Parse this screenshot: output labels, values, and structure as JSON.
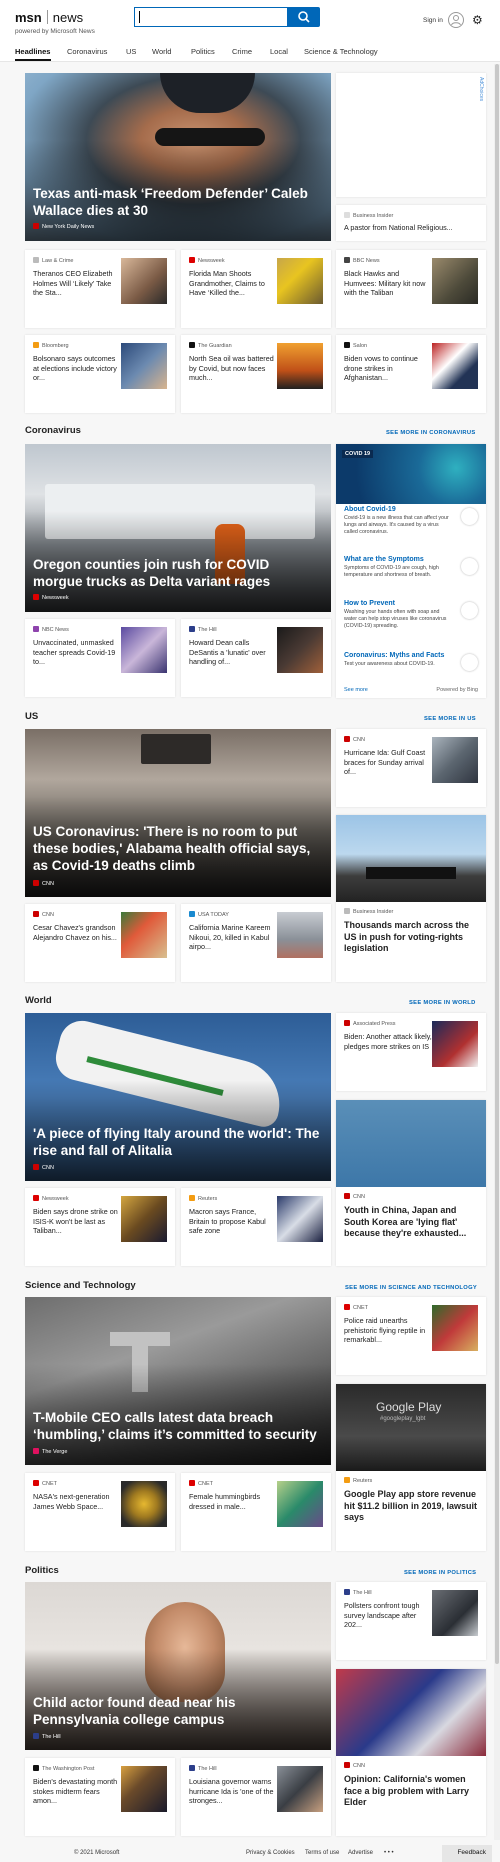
{
  "header": {
    "logo_text": "msn",
    "news": "news",
    "powered": "powered by Microsoft News",
    "sign_in": "Sign in",
    "search_value": ""
  },
  "nav": [
    "Headlines",
    "Coronavirus",
    "US",
    "World",
    "Politics",
    "Crime",
    "Local",
    "Science & Technology"
  ],
  "top": {
    "hero": {
      "title": "Texas anti-mask ‘Freedom Defender’ Caleb Wallace dies at 30",
      "source": "New York Daily News"
    },
    "side": {
      "source": "Business Insider",
      "title": "A pastor from National Religious..."
    },
    "ad_label": "AdChoices",
    "stories": [
      {
        "source": "Law & Crime",
        "title": "Theranos CEO Elizabeth Holmes Will ‘Likely’ Take the Sta..."
      },
      {
        "source": "Newsweek",
        "title": "Florida Man Shoots Grandmother, Claims to Have ‘Killed the..."
      },
      {
        "source": "BBC News",
        "title": "Black Hawks and Humvees: Military kit now with the Taliban"
      },
      {
        "source": "Bloomberg",
        "title": "Bolsonaro says outcomes at elections include victory or..."
      },
      {
        "source": "The Guardian",
        "title": "North Sea oil was battered by Covid, but now faces much..."
      },
      {
        "source": "Salon",
        "title": "Biden vows to continue drone strikes in Afghanistan..."
      }
    ]
  },
  "coronavirus": {
    "heading": "Coronavirus",
    "more": "SEE MORE IN CORONAVIRUS",
    "hero": {
      "title": "Oregon counties join rush for COVID morgue trucks as Delta variant rages",
      "source": "Newsweek"
    },
    "stories": [
      {
        "source": "NBC News",
        "title": "Unvaccinated, unmasked teacher spreads Covid-19 to..."
      },
      {
        "source": "The Hill",
        "title": "Howard Dean calls DeSantis a 'lunatic' over handling of..."
      }
    ],
    "panel": {
      "badge": "COVID 19",
      "items": [
        {
          "h": "About Covid-19",
          "d": "Covid-19 is a new illness that can affect your lungs and airways. It's caused by a virus called coronavirus."
        },
        {
          "h": "What are the Symptoms",
          "d": "Symptoms of COVID-19 are cough, high temperature and shortness of breath."
        },
        {
          "h": "How to Prevent",
          "d": "Washing your hands often with soap and water can help stop viruses like coronavirus (COVID-19) spreading."
        },
        {
          "h": "Coronavirus: Myths and Facts",
          "d": "Test your awareness about COVID-19."
        }
      ],
      "see_more": "See more",
      "powered": "Powered by Bing"
    }
  },
  "us": {
    "heading": "US",
    "more": "SEE MORE IN US",
    "hero": {
      "title": "US Coronavirus: 'There is no room to put these bodies,' Alabama health official says, as Covid-19 deaths climb",
      "source": "CNN"
    },
    "side": {
      "source": "CNN",
      "title": "Hurricane Ida: Gulf Coast braces for Sunday arrival of..."
    },
    "stories": [
      {
        "source": "CNN",
        "title": "Cesar Chavez's grandson Alejandro Chavez on his..."
      },
      {
        "source": "USA TODAY",
        "title": "California Marine Kareem Nikoui, 20, killed in Kabul airpo..."
      }
    ],
    "feature": {
      "source": "Business Insider",
      "title": "Thousands march across the US in push for voting-rights legislation"
    }
  },
  "world": {
    "heading": "World",
    "more": "SEE MORE IN WORLD",
    "hero": {
      "title": "'A piece of flying Italy around the world': The rise and fall of Alitalia",
      "source": "CNN"
    },
    "side": {
      "source": "Associated Press",
      "title": "Biden: Another attack likely, pledges more strikes on IS"
    },
    "stories": [
      {
        "source": "Newsweek",
        "title": "Biden says drone strike on ISIS-K won't be last as Taliban..."
      },
      {
        "source": "Reuters",
        "title": "Macron says France, Britain to propose Kabul safe zone"
      }
    ],
    "feature": {
      "source": "CNN",
      "title": "Youth in China, Japan and South Korea are 'lying flat' because they're exhausted..."
    }
  },
  "science": {
    "heading": "Science and Technology",
    "more": "SEE MORE IN SCIENCE AND TECHNOLOGY",
    "hero": {
      "title": "T-Mobile CEO calls latest data breach ‘humbling,’ claims it’s committed to security",
      "source": "The Verge"
    },
    "side": {
      "source": "CNET",
      "title": "Police raid unearths prehistoric flying reptile in remarkabl..."
    },
    "stories": [
      {
        "source": "CNET",
        "title": "NASA's next-generation James Webb Space..."
      },
      {
        "source": "CNET",
        "title": "Female hummingbirds dressed in male..."
      }
    ],
    "feature": {
      "source": "Reuters",
      "title": "Google Play app store revenue hit $11.2 billion in 2019, lawsuit says",
      "img_text": "Google Play",
      "img_sub": "#googleplay_lgbt"
    }
  },
  "politics": {
    "heading": "Politics",
    "more": "SEE MORE IN POLITICS",
    "hero": {
      "title": "Child actor found dead near his Pennsylvania college campus",
      "source": "The Hill"
    },
    "side": {
      "source": "The Hill",
      "title": "Pollsters confront tough survey landscape after 202..."
    },
    "stories": [
      {
        "source": "The Washington Post",
        "title": "Biden's devastating month stokes midterm fears amon..."
      },
      {
        "source": "The Hill",
        "title": "Louisiana governor warns hurricane Ida is 'one of the stronges..."
      }
    ],
    "feature": {
      "source": "CNN",
      "title": "Opinion: California's women face a big problem with Larry Elder"
    }
  },
  "footer": {
    "copy": "© 2021 Microsoft",
    "links": [
      "Privacy & Cookies",
      "Terms of use",
      "Advertise"
    ],
    "more": "• • •",
    "feedback": "Feedback"
  }
}
